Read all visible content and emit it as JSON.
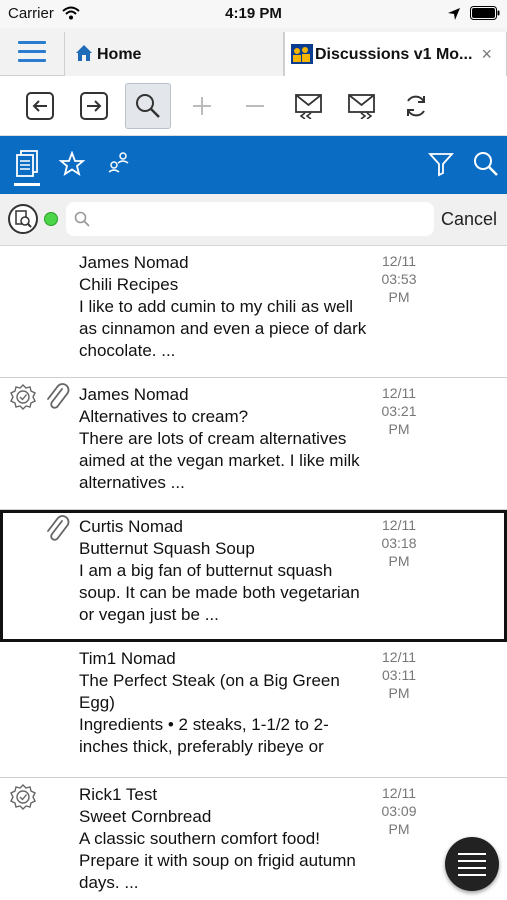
{
  "status_bar": {
    "carrier": "Carrier",
    "time": "4:19 PM"
  },
  "tabs": [
    {
      "label": "Home"
    },
    {
      "label": "Discussions v1 Mo...",
      "close": "×"
    }
  ],
  "search": {
    "placeholder": "",
    "value": "",
    "cancel_label": "Cancel"
  },
  "colors": {
    "accent": "#0b6cc4",
    "status_dot": "#4cd548"
  },
  "messages": [
    {
      "author": "James Nomad",
      "subject": "Chili Recipes",
      "snippet": "I like to add cumin to my chili as well as cinnamon and even a piece of dark chocolate. ...",
      "date": "12/11",
      "time": "03:53",
      "ampm": "PM"
    },
    {
      "author": "James Nomad",
      "subject": "Alternatives to cream?",
      "snippet": "There are lots of cream alternatives aimed at the vegan market. I like milk alternatives ...",
      "date": "12/11",
      "time": "03:21",
      "ampm": "PM"
    },
    {
      "author": "Curtis Nomad",
      "subject": "Butternut Squash Soup",
      "snippet": "I am a big fan of butternut squash soup. It can be made both vegetarian or vegan just be ...",
      "date": "12/11",
      "time": "03:18",
      "ampm": "PM"
    },
    {
      "author": "Tim1 Nomad",
      "subject": "The Perfect Steak (on a Big Green Egg)",
      "snippet": "Ingredients  • 2 steaks, 1-1/2 to 2-inches thick, preferably ribeye or",
      "date": "12/11",
      "time": "03:11",
      "ampm": "PM"
    },
    {
      "author": "Rick1 Test",
      "subject": "Sweet Cornbread",
      "snippet": "A classic southern comfort food! Prepare it with soup on frigid autumn days. ...",
      "date": "12/11",
      "time": "03:09",
      "ampm": "PM"
    }
  ]
}
